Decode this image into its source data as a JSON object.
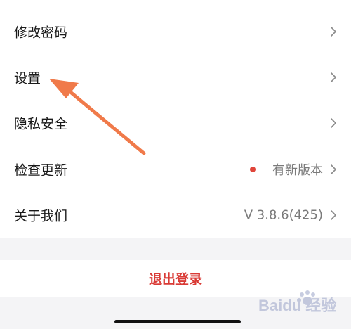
{
  "menu": {
    "items": [
      {
        "label": "修改密码"
      },
      {
        "label": "设置"
      },
      {
        "label": "隐私安全"
      },
      {
        "label": "检查更新",
        "value": "有新版本"
      },
      {
        "label": "关于我们",
        "value": "V 3.8.6(425)"
      }
    ]
  },
  "logout": {
    "label": "退出登录"
  },
  "colors": {
    "accent_red": "#d93a35",
    "update_dot": "#e0453a",
    "arrow_orange": "#f07a4a",
    "background": "#f4f4f6"
  },
  "icons": {
    "chevron": "chevron-right-icon",
    "annotation": "annotation-arrow-icon",
    "watermark": "baidu-jingyan-watermark"
  },
  "watermark": {
    "text": "Baidu 经验"
  }
}
